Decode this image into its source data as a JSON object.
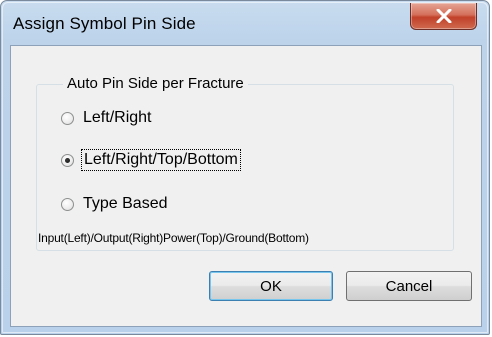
{
  "window": {
    "title": "Assign Symbol Pin Side",
    "close_icon": "close-icon"
  },
  "group": {
    "legend": "Auto Pin Side per Fracture",
    "options": [
      {
        "label": "Left/Right",
        "checked": false
      },
      {
        "label": "Left/Right/Top/Bottom",
        "checked": true
      },
      {
        "label": "Type Based",
        "checked": false
      }
    ],
    "type_based_description": "Input(Left)/Output(Right)Power(Top)/Ground(Bottom)"
  },
  "buttons": {
    "ok_label": "OK",
    "cancel_label": "Cancel"
  },
  "colors": {
    "frame": "#bcd3ea",
    "close_button": "#c1412a",
    "client_bg": "#f0f0f0"
  }
}
